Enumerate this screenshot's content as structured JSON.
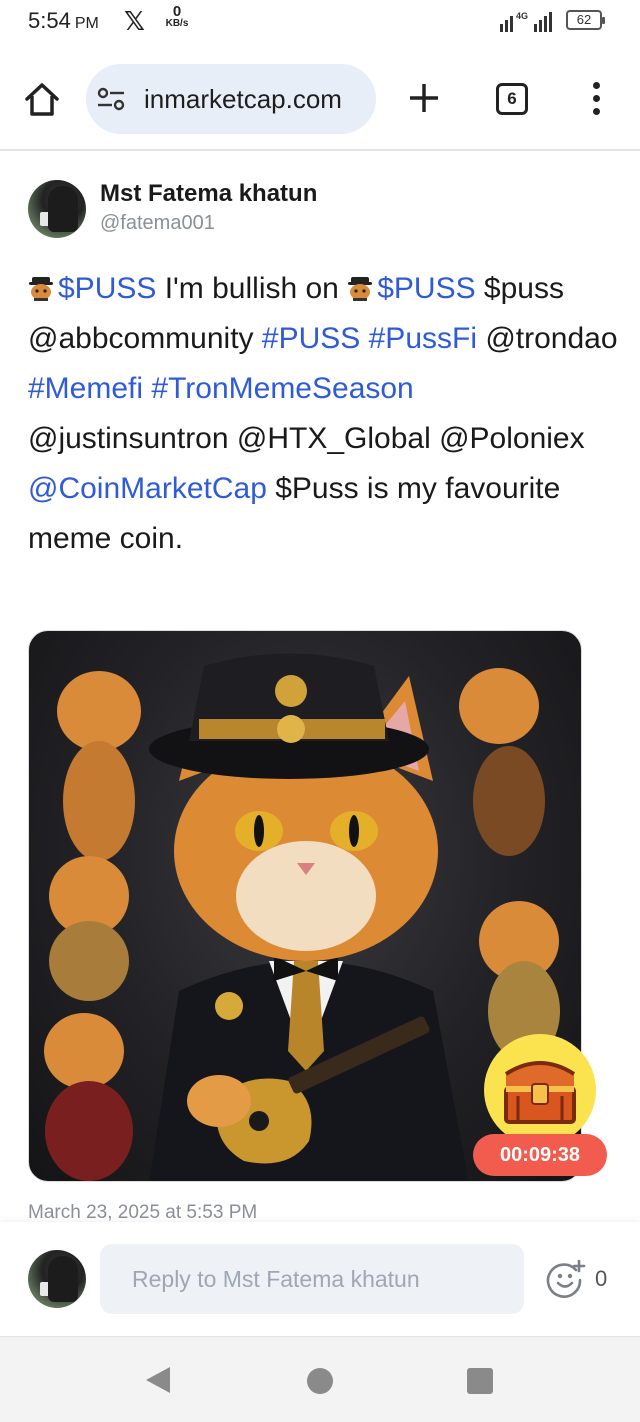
{
  "status_bar": {
    "time": "5:54",
    "ampm": "PM",
    "x_logo": "𝕏",
    "speed_value": "0",
    "speed_unit": "KB/s",
    "battery": "62",
    "network": "4G"
  },
  "browser": {
    "url": "inmarketcap.com",
    "tab_count": "6",
    "icons": {
      "home": "home-icon",
      "site_settings": "tune-icon",
      "new_tab": "plus-icon",
      "tabs": "tabs-icon",
      "menu": "more-vert-icon"
    }
  },
  "post": {
    "author_name": "Mst Fatema khatun",
    "author_handle": "@fatema001",
    "body": [
      {
        "t": "emoji"
      },
      {
        "t": "tag",
        "v": "$PUSS"
      },
      {
        "t": "text",
        "v": " I'm bullish on "
      },
      {
        "t": "emoji"
      },
      {
        "t": "tag",
        "v": "$PUSS"
      },
      {
        "t": "text",
        "v": " $puss @abbcommunity "
      },
      {
        "t": "tag",
        "v": "#PUSS"
      },
      {
        "t": "text",
        "v": " "
      },
      {
        "t": "tag",
        "v": "#PussFi"
      },
      {
        "t": "text",
        "v": " @trondao "
      },
      {
        "t": "tag",
        "v": "#Memefi"
      },
      {
        "t": "text",
        "v": " "
      },
      {
        "t": "tag",
        "v": "#TronMemeSeason"
      },
      {
        "t": "text",
        "v": " @justinsuntron @HTX_Global @Poloniex "
      },
      {
        "t": "tag",
        "v": "@CoinMarketCap"
      },
      {
        "t": "text",
        "v": " $Puss is my favourite meme coin."
      }
    ],
    "timestamp": "March 23, 2025 at 5:53 PM",
    "link_color": "#2f5bd8"
  },
  "reward": {
    "timer": "00:09:38",
    "icon": "treasure-chest-icon"
  },
  "reply": {
    "placeholder": "Reply to Mst Fatema khatun",
    "reaction_count": "0",
    "icon": "add-reaction-icon"
  },
  "nav": {
    "icons": [
      "back-icon",
      "home-circle-icon",
      "recents-icon"
    ]
  }
}
